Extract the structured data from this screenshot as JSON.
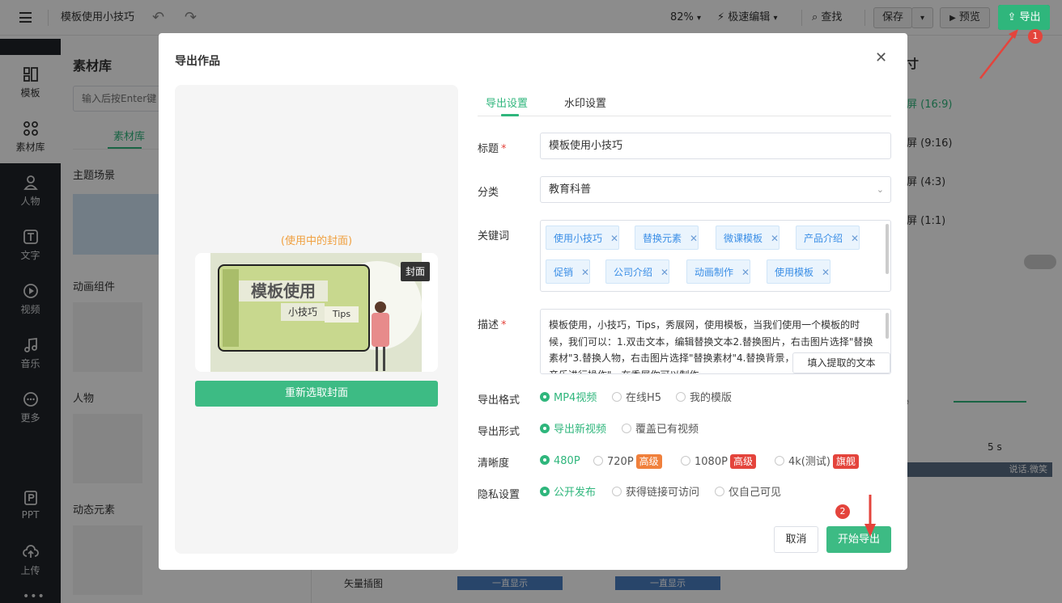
{
  "topbar": {
    "menu_icon": "menu-icon",
    "doc_title": "模板使用小技巧",
    "zoom": "82%",
    "edit_mode": "极速编辑",
    "find": "查找",
    "save": "保存",
    "preview": "预览",
    "export": "导出"
  },
  "leftnav": {
    "items": [
      {
        "label": "模板",
        "icon": "template-icon"
      },
      {
        "label": "素材库",
        "icon": "grid-icon"
      },
      {
        "label": "人物",
        "icon": "person-icon"
      },
      {
        "label": "文字",
        "icon": "text-icon"
      },
      {
        "label": "视频",
        "icon": "play-icon"
      },
      {
        "label": "音乐",
        "icon": "music-icon"
      },
      {
        "label": "更多",
        "icon": "more-icon"
      },
      {
        "label": "PPT",
        "icon": "ppt-icon"
      },
      {
        "label": "上传",
        "icon": "upload-icon"
      }
    ]
  },
  "material": {
    "title": "素材库",
    "search_placeholder": "输入后按Enter键",
    "tab": "素材库",
    "sections": [
      "主题场景",
      "动画组件",
      "人物",
      "动态元素"
    ],
    "badge_flagship": "旗舰",
    "badge_premium": "高级"
  },
  "right": {
    "size_title": "寸",
    "sizes": [
      "屏 (16:9)",
      "屏 (9:16)",
      "屏 (4:3)",
      "屏 (1:1)"
    ],
    "timeline_sec": "5 s",
    "seconds_abbr": "秒",
    "track_text": "说话.微笑",
    "vector": "矢量插图",
    "always_show": "一直显示"
  },
  "dialog": {
    "title": "导出作品",
    "cover_caption": "(使用中的封面)",
    "cover_badge": "封面",
    "reselect_cover": "重新选取封面",
    "thumb_title": "模板使用",
    "thumb_sub": "小技巧",
    "thumb_tips": "Tips",
    "tabs": [
      "导出设置",
      "水印设置"
    ],
    "fields": {
      "title_label": "标题",
      "title_value": "模板使用小技巧",
      "category_label": "分类",
      "category_value": "教育科普",
      "keywords_label": "关键词",
      "keywords": [
        "使用小技巧",
        "替换元素",
        "微课模板",
        "产品介绍",
        "促销",
        "公司介绍",
        "动画制作",
        "使用模板"
      ],
      "desc_label": "描述",
      "desc_value": "模板使用，小技巧，Tips，秀展网，使用模板，当我们使用一个模板的时候，我们可以：1.双击文本，编辑替换文本2.替换图片，右击图片选择\"替换素材\"3.替换人物，右击图片选择\"替换素材\"4.替换背景，点击右上角的\"背景音乐进行操作\"，在秀展你可以制作",
      "fill_text": "填入提取的文本",
      "format_label": "导出格式",
      "format_options": [
        "MP4视频",
        "在线H5",
        "我的模版"
      ],
      "form_label": "导出形式",
      "form_options": [
        "导出新视频",
        "覆盖已有视频"
      ],
      "quality_label": "清晰度",
      "quality_options": [
        "480P",
        "720P",
        "1080P",
        "4k(测试)"
      ],
      "quality_badges": [
        "高级",
        "高级",
        "旗舰"
      ],
      "privacy_label": "隐私设置",
      "privacy_options": [
        "公开发布",
        "获得链接可访问",
        "仅自己可见"
      ]
    },
    "cancel": "取消",
    "start_export": "开始导出"
  },
  "annotations": {
    "step1": "1",
    "step2": "2"
  },
  "colors": {
    "accent": "#2fb67c",
    "sidebar": "#1f2329",
    "arrow": "#e4443c",
    "badge_orange": "#f0803c",
    "badge_red": "#e4443c"
  }
}
